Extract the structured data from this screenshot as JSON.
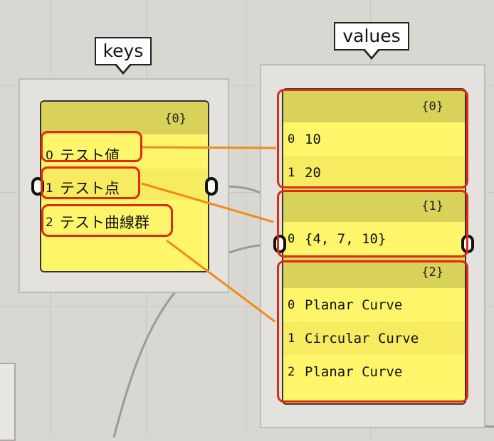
{
  "callouts": {
    "keys": "keys",
    "values": "values"
  },
  "keys_panel": {
    "header": "{0}",
    "items": [
      {
        "index": "0",
        "label": "テスト値"
      },
      {
        "index": "1",
        "label": "テスト点"
      },
      {
        "index": "2",
        "label": "テスト曲線群"
      }
    ]
  },
  "values_panel": {
    "branches": [
      {
        "header": "{0}",
        "items": [
          {
            "index": "0",
            "value": "10"
          },
          {
            "index": "1",
            "value": "20"
          }
        ]
      },
      {
        "header": "{1}",
        "items": [
          {
            "index": "0",
            "value": "{4, 7, 10}"
          }
        ]
      },
      {
        "header": "{2}",
        "items": [
          {
            "index": "0",
            "value": "Planar Curve"
          },
          {
            "index": "1",
            "value": "Circular Curve"
          },
          {
            "index": "2",
            "value": "Planar Curve"
          }
        ]
      }
    ]
  },
  "colors": {
    "panel": "#fff66b",
    "panel_header": "#d9d25a",
    "highlight": "#e02a12",
    "arrow": "#f28a1a"
  }
}
